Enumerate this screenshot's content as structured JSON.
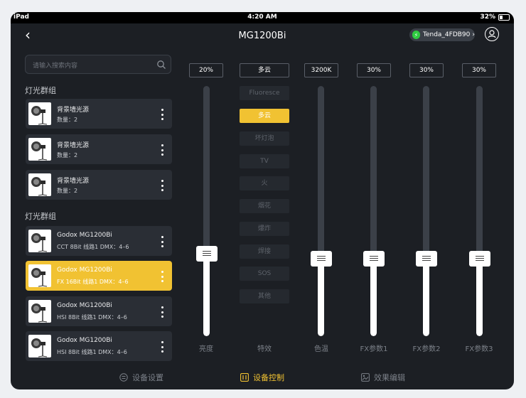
{
  "status_bar": {
    "device": "iPad",
    "time": "4:20 AM",
    "battery": "32%"
  },
  "header": {
    "title": "MG1200Bi",
    "wifi_name": "Tenda_4FDB90",
    "wifi_chevron": "›"
  },
  "search": {
    "placeholder": "请输入搜索内容"
  },
  "groups": [
    {
      "title": "灯光群组",
      "items": [
        {
          "name": "背景墙光源",
          "sub": "数量：2"
        },
        {
          "name": "背景墙光源",
          "sub": "数量：2"
        },
        {
          "name": "背景墙光源",
          "sub": "数量：2"
        }
      ]
    },
    {
      "title": "灯光群组",
      "items": [
        {
          "name": "Godox MG1200Bi",
          "sub": "CCT   8Bit   线路1 DMX：4–6"
        },
        {
          "name": "Godox MG1200Bi",
          "sub": "FX   16Bit   线路1 DMX：4–6"
        },
        {
          "name": "Godox MG1200Bi",
          "sub": "HSI   8Bit   线路1 DMX：4–6"
        },
        {
          "name": "Godox MG1200Bi",
          "sub": "HSI   8Bit   线路1 DMX：4–6"
        }
      ]
    }
  ],
  "sliders": [
    {
      "value": "20%",
      "label": "亮度",
      "level": 0.33
    },
    {
      "value": "多云",
      "label": "特效"
    },
    {
      "value": "3200K",
      "label": "色温",
      "level": 0.31
    },
    {
      "value": "30%",
      "label": "FX参数1",
      "level": 0.31
    },
    {
      "value": "30%",
      "label": "FX参数2",
      "level": 0.31
    },
    {
      "value": "30%",
      "label": "FX参数3",
      "level": 0.31
    }
  ],
  "effects": [
    "Fluoresce",
    "多云",
    "坏灯泡",
    "TV",
    "火",
    "烟花",
    "爆炸",
    "焊接",
    "SOS",
    "其他"
  ],
  "tabs": [
    {
      "label": "设备设置",
      "icon": "settings-circle-icon"
    },
    {
      "label": "设备控制",
      "icon": "control-panel-icon"
    },
    {
      "label": "效果编辑",
      "icon": "image-edit-icon"
    }
  ],
  "colors": {
    "accent": "#f1c232",
    "background": "#1c1f24",
    "item_bg": "#2a2e35",
    "wifi_status": "#2ecc40"
  }
}
